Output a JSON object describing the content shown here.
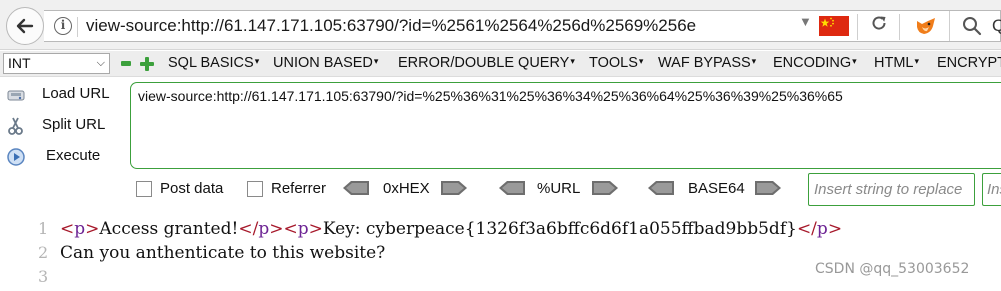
{
  "browser": {
    "url": "view-source:http://61.147.171.105:63790/?id=%2561%2564%256d%2569%256e",
    "search_text": "Q"
  },
  "hackbar": {
    "type_select": "INT",
    "menus": [
      "SQL BASICS",
      "UNION BASED",
      "ERROR/DOUBLE QUERY",
      "TOOLS",
      "WAF BYPASS",
      "ENCODING",
      "HTML",
      "ENCRYPT"
    ],
    "actions": {
      "load_url": "Load URL",
      "split_url": "Split URL",
      "execute": "Execute"
    },
    "textarea_value": "view-source:http://61.147.171.105:63790/?id=%25%36%31%25%36%34%25%36%64%25%36%39%25%36%65",
    "post_data_label": "Post data",
    "referrer_label": "Referrer",
    "converters": [
      "0xHEX",
      "%URL",
      "BASE64"
    ],
    "replace_placeholder": "Insert string to replace",
    "replace_with_placeholder": "Insert"
  },
  "source": {
    "line_numbers": [
      "1",
      "2",
      "3"
    ],
    "line1": {
      "open_lt": "<",
      "p_open1": "p",
      "open_gt": ">",
      "text1": "Access granted!",
      "close1_lt": "</",
      "p_close1": "p",
      "close1_gt": ">",
      "open2_lt": "<",
      "p_open2": "p",
      "open2_gt": ">",
      "text2": "Key: cyberpeace{1326f3a6bffc6d6f1a055ffbad9bb5df}",
      "close2_lt": "</",
      "p_close2": "p",
      "close2_gt": ">"
    },
    "line2": "Can you anthenticate to this website?",
    "line3": ""
  },
  "watermark": "CSDN @qq_53003652",
  "colors": {
    "accent_green": "#3ca03c",
    "tag_bracket": "#a6182a",
    "tag_name": "#6d2494",
    "flag_red": "#de2910"
  }
}
